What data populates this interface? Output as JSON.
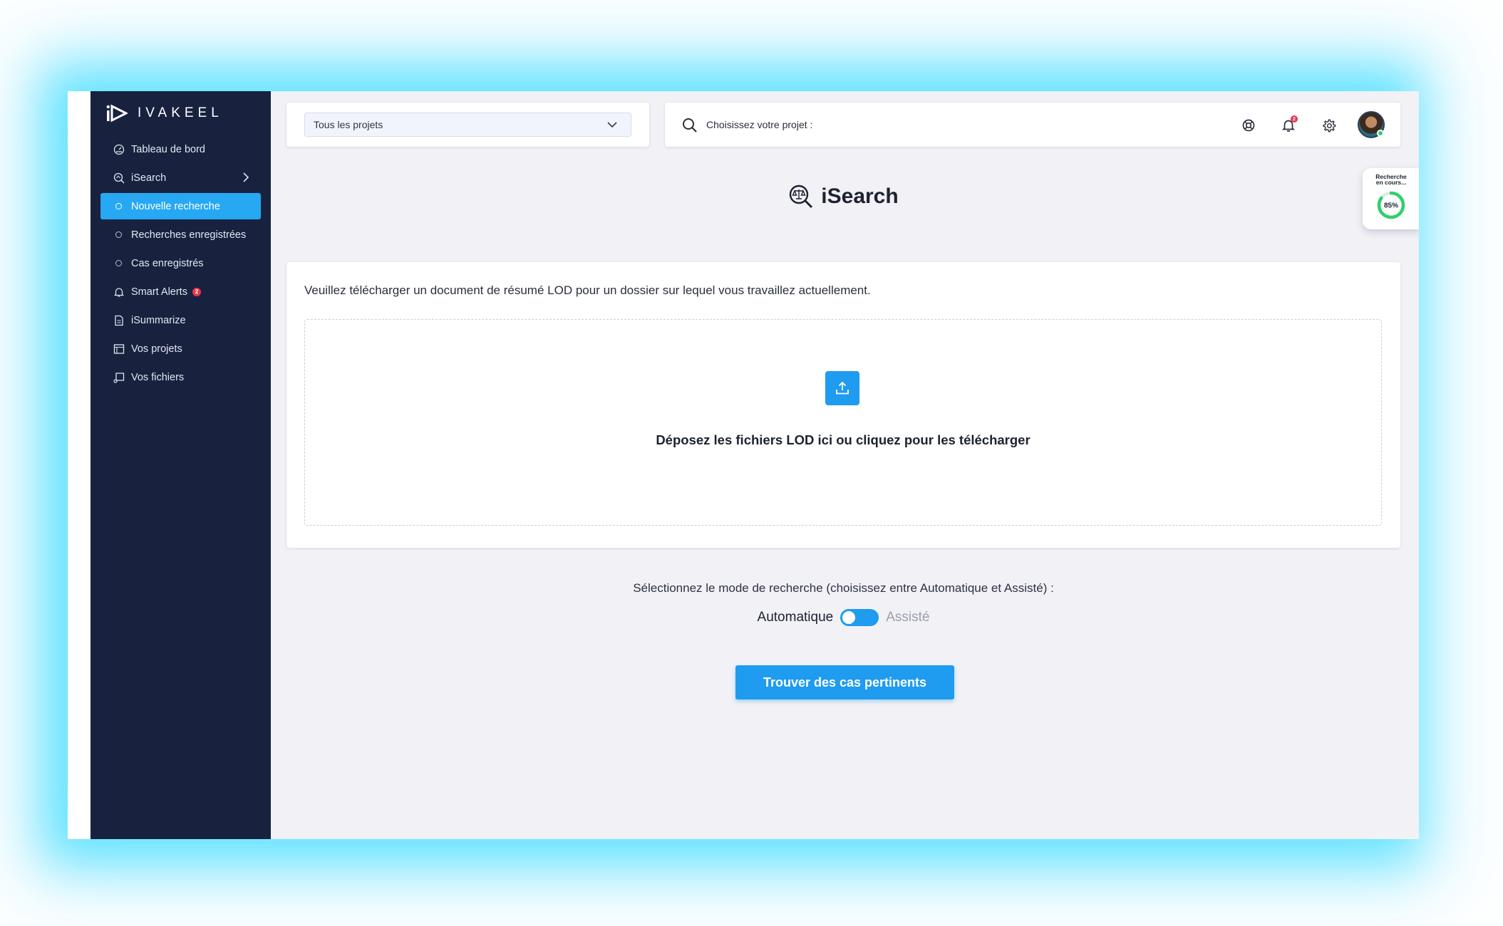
{
  "brand": {
    "name": "IVAKEEL"
  },
  "sidebar": {
    "items": [
      {
        "label": "Tableau de bord",
        "icon": "dashboard-icon"
      },
      {
        "label": "iSearch",
        "icon": "isearch-icon"
      },
      {
        "label": "Nouvelle recherche",
        "active": true
      },
      {
        "label": "Recherches enregistrées"
      },
      {
        "label": "Cas enregistrés"
      },
      {
        "label": "Smart Alerts",
        "icon": "bell-icon",
        "badge": "2"
      },
      {
        "label": "iSummarize",
        "icon": "document-icon"
      },
      {
        "label": "Vos projets",
        "icon": "projects-icon"
      },
      {
        "label": "Vos fichiers",
        "icon": "files-icon"
      }
    ]
  },
  "header": {
    "project_select": {
      "value": "Tous les projets"
    },
    "search": {
      "placeholder": "Choisissez votre projet :"
    },
    "notifications_badge": "2"
  },
  "page": {
    "title": "iSearch"
  },
  "progress": {
    "label_line1": "Recherche",
    "label_line2": "en cours...",
    "value": 85,
    "display": "85%"
  },
  "upload": {
    "instruction": "Veuillez télécharger un document de résumé LOD pour un dossier sur lequel vous travaillez actuellement.",
    "drop_text": "Déposez les fichiers LOD ici ou cliquez pour les télécharger"
  },
  "mode": {
    "label": "Sélectionnez le mode de recherche (choisissez entre Automatique et Assisté) :",
    "option_auto": "Automatique",
    "option_assist": "Assisté",
    "selected": "Automatique"
  },
  "actions": {
    "find_label": "Trouver des cas pertinents"
  },
  "colors": {
    "sidebar": "#18223f",
    "accent": "#1f9bf0",
    "active_nav": "#27a8f3",
    "badge": "#e8374d",
    "progress": "#2fd06a"
  }
}
